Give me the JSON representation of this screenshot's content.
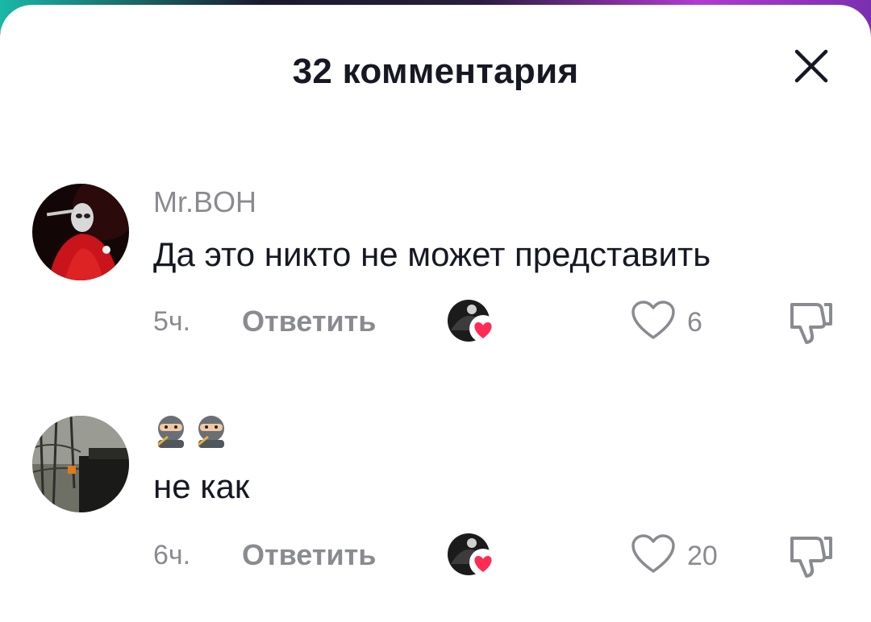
{
  "header": {
    "title": "32 комментария",
    "close_icon": "close-icon"
  },
  "comments": [
    {
      "author": "Mr.BOH",
      "text": "Да это никто не может представить",
      "time": "5ч.",
      "reply_label": "Ответить",
      "likes": "6",
      "liked_by_creator": true
    },
    {
      "author": "🥷🥷",
      "text": "не как",
      "time": "6ч.",
      "reply_label": "Ответить",
      "likes": "20",
      "liked_by_creator": true
    }
  ],
  "colors": {
    "text_primary": "#161823",
    "text_secondary": "#8a8b91",
    "heart_red": "#fe2c55"
  }
}
